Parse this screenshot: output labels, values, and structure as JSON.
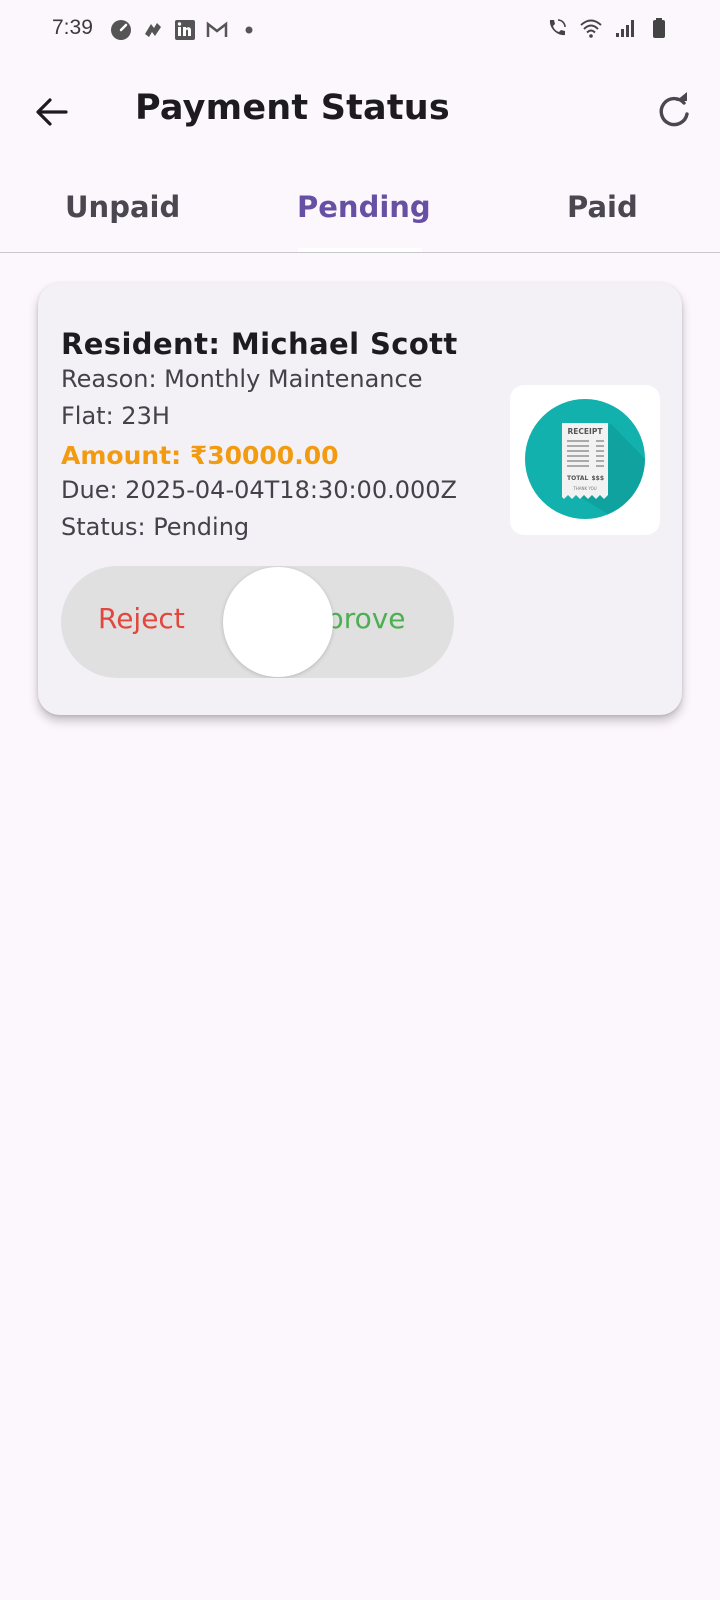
{
  "status_bar": {
    "time": "7:39",
    "left_icons": [
      "speedometer-icon",
      "app-icon",
      "linkedin-icon",
      "gmail-icon",
      "dot-icon"
    ],
    "right_icons": [
      "wifi-call-icon",
      "wifi-icon",
      "signal-icon",
      "battery-icon"
    ]
  },
  "appbar": {
    "title": "Payment Status",
    "back_icon": "arrow-left-icon",
    "refresh_icon": "refresh-icon"
  },
  "tabs": [
    {
      "label": "Unpaid",
      "active": false
    },
    {
      "label": "Pending",
      "active": true
    },
    {
      "label": "Paid",
      "active": false
    }
  ],
  "payment": {
    "resident": "Resident: Michael Scott",
    "reason": "Reason: Monthly Maintenance",
    "flat": "Flat: 23H",
    "amount": "Amount: ₹30000.00",
    "due": "Due: 2025-04-04T18:30:00.000Z",
    "status": "Status: Pending",
    "receipt_icon": "receipt-icon",
    "receipt_text": {
      "title": "RECEIPT",
      "total": "TOTAL",
      "amount": "$$$",
      "footer": "THANK YOU"
    }
  },
  "swipe_action": {
    "reject_label": "Reject",
    "approve_label": "Approve"
  },
  "colors": {
    "background": "#fcf6fd",
    "accent": "#6750a4",
    "amount": "#f29b11",
    "reject": "#e2463c",
    "approve": "#4caf50",
    "receipt_circle": "#12b1ad"
  }
}
